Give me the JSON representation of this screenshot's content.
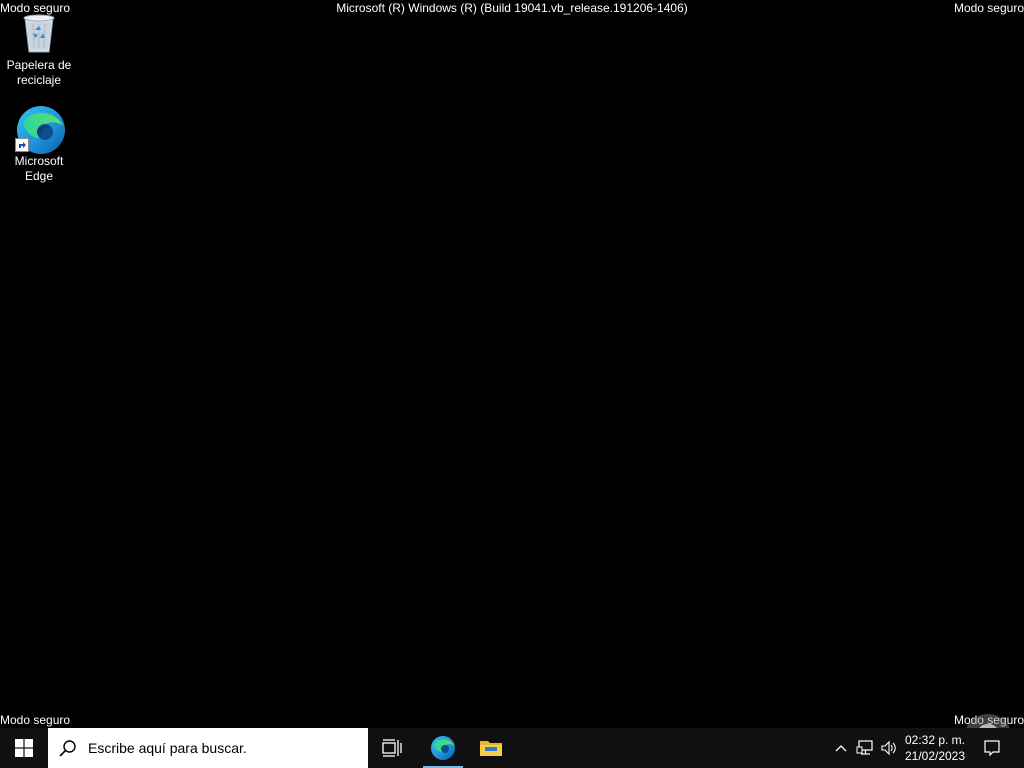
{
  "watermarks": {
    "top_left": "Modo seguro",
    "top_right": "Modo seguro",
    "bottom_left": "Modo seguro",
    "bottom_right": "Modo seguro",
    "title": "Microsoft (R) Windows (R) (Build 19041.vb_release.191206-1406)"
  },
  "desktop_icons": [
    {
      "label_line1": "Papelera de",
      "label_line2": "reciclaje",
      "icon": "recycle-bin-icon"
    },
    {
      "label_line1": "Microsoft",
      "label_line2": "Edge",
      "icon": "edge-icon"
    }
  ],
  "taskbar": {
    "search_placeholder": "Escribe aquí para buscar.",
    "apps": [
      {
        "name": "task-view",
        "icon": "task-view-icon"
      },
      {
        "name": "edge",
        "icon": "edge-icon",
        "active": true
      },
      {
        "name": "file-explorer",
        "icon": "folder-icon"
      }
    ],
    "clock_time": "02:32 p. m.",
    "clock_date": "21/02/2023"
  },
  "colors": {
    "desktop_bg": "#000000",
    "taskbar_bg": "#101010",
    "accent": "#76b9ed"
  }
}
